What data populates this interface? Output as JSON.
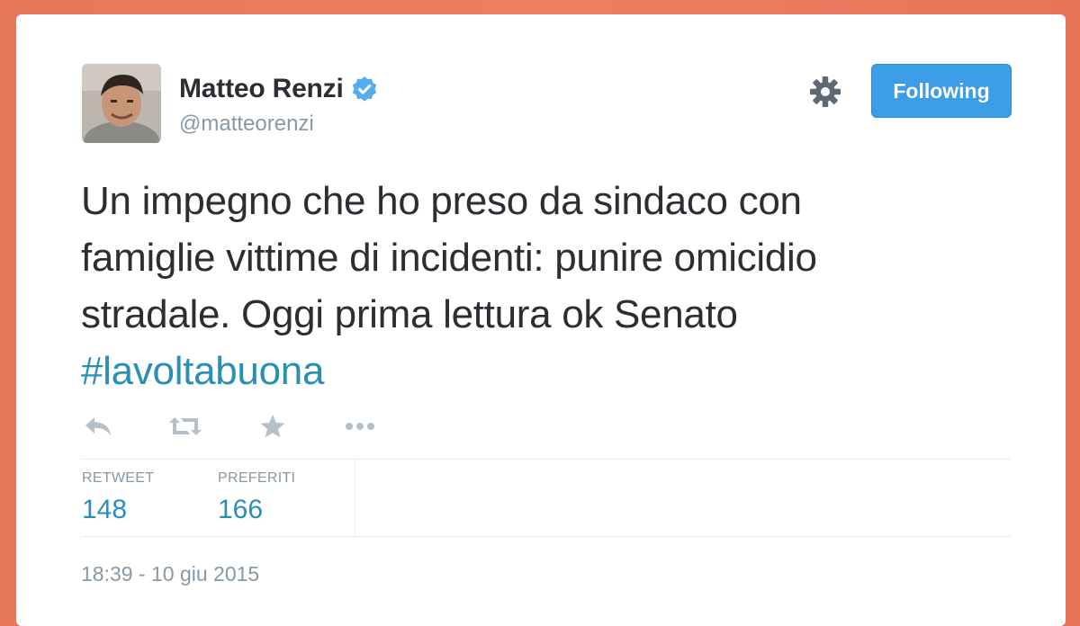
{
  "user": {
    "name": "Matteo Renzi",
    "handle": "@matteorenzi"
  },
  "follow_button": {
    "label": "Following"
  },
  "tweet": {
    "lines": [
      "Un impegno che ho preso da sindaco con",
      "famiglie vittime di incidenti: punire omicidio",
      "stradale. Oggi prima lettura ok Senato"
    ],
    "hashtag": "#lavoltabuona"
  },
  "stats": {
    "retweet_label": "RETWEET",
    "retweet_count": "148",
    "favorites_label": "PREFERITI",
    "favorites_count": "166"
  },
  "timestamp": "18:39 - 10 giu 2015",
  "icons": [
    "reply-icon",
    "retweet-icon",
    "favorite-icon",
    "more-icon",
    "gear-icon",
    "verified-icon"
  ],
  "colors": {
    "background": "#ec7a5e",
    "button": "#3d9ee8",
    "link": "#2b8fb5",
    "verified": "#55acee",
    "muted": "#8899a6"
  }
}
